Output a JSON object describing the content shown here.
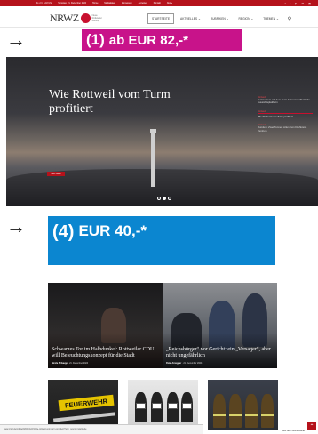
{
  "topbar": {
    "links": [
      "Mo • Fr. 8-18 Uhr",
      "Samstag, 21. Dezember 2024",
      "Home",
      "Mediadaten",
      "Impressum",
      "Anzeigen",
      "Kontakt",
      "Abo »"
    ],
    "socials": [
      "f",
      "t",
      "▶",
      "✉",
      "▣"
    ]
  },
  "header": {
    "logo_text": "NRWZ",
    "logo_sub": "Neue Rottweiler Zeitung",
    "nav": [
      {
        "label": "STARTSEITE",
        "active": true
      },
      {
        "label": "AKTUELLES ⌄",
        "active": false
      },
      {
        "label": "RUBRIKEN ⌄",
        "active": false
      },
      {
        "label": "REGION ⌄",
        "active": false
      },
      {
        "label": "THEMEN ⌄",
        "active": false
      }
    ],
    "search_icon": "search-icon"
  },
  "offer_top": {
    "number": "(1)",
    "price": "ab EUR 82,-*",
    "color": "#c8138a"
  },
  "offer_bottom": {
    "number": "(4)",
    "price": "EUR 40,-*",
    "color": "#0b86d0"
  },
  "arrow_glyph": "→",
  "hero": {
    "title": "Wie Rottweil vom Turm profitiert",
    "button": "Mehr lesen",
    "sidebar": [
      {
        "category": "Rottweil",
        "text": "Testzentrum auf dem Turm bekommt öffentliche Aussichtsplattform"
      },
      {
        "category": "Rottweil",
        "text": "Wie Rottweil vom Turm profitiert",
        "active": true
      },
      {
        "category": "Rottweil",
        "text": "Rundum: Zwei Tonnen rollen zum Drehkreis-Zentrum"
      }
    ]
  },
  "tiles": [
    {
      "title": "Schwarzes Tor im Halbdunkel: Rottweiler CDU will Beleuchtungskonzept für die Stadt",
      "author": "Nicole Schaupp",
      "date": "21. Dezember 2024"
    },
    {
      "title": "„Reichsbürger“ vor Gericht: ein „Versager“, aber nicht ungefährlich",
      "author": "Peter Arnegger",
      "date": "21. Dezember 2024"
    }
  ],
  "thumbs": [
    {
      "label": "FEUERWEHR"
    },
    {
      "label": ""
    },
    {
      "label": ""
    }
  ],
  "thumb_caption": "Aus dem Gemeinderat",
  "statusbar": "www.nrwz.de/rottweil/2024/12/21/wie-rottweil-vom-turm-profitiert/?utm_source=startseite",
  "to_top_glyph": "⌃"
}
